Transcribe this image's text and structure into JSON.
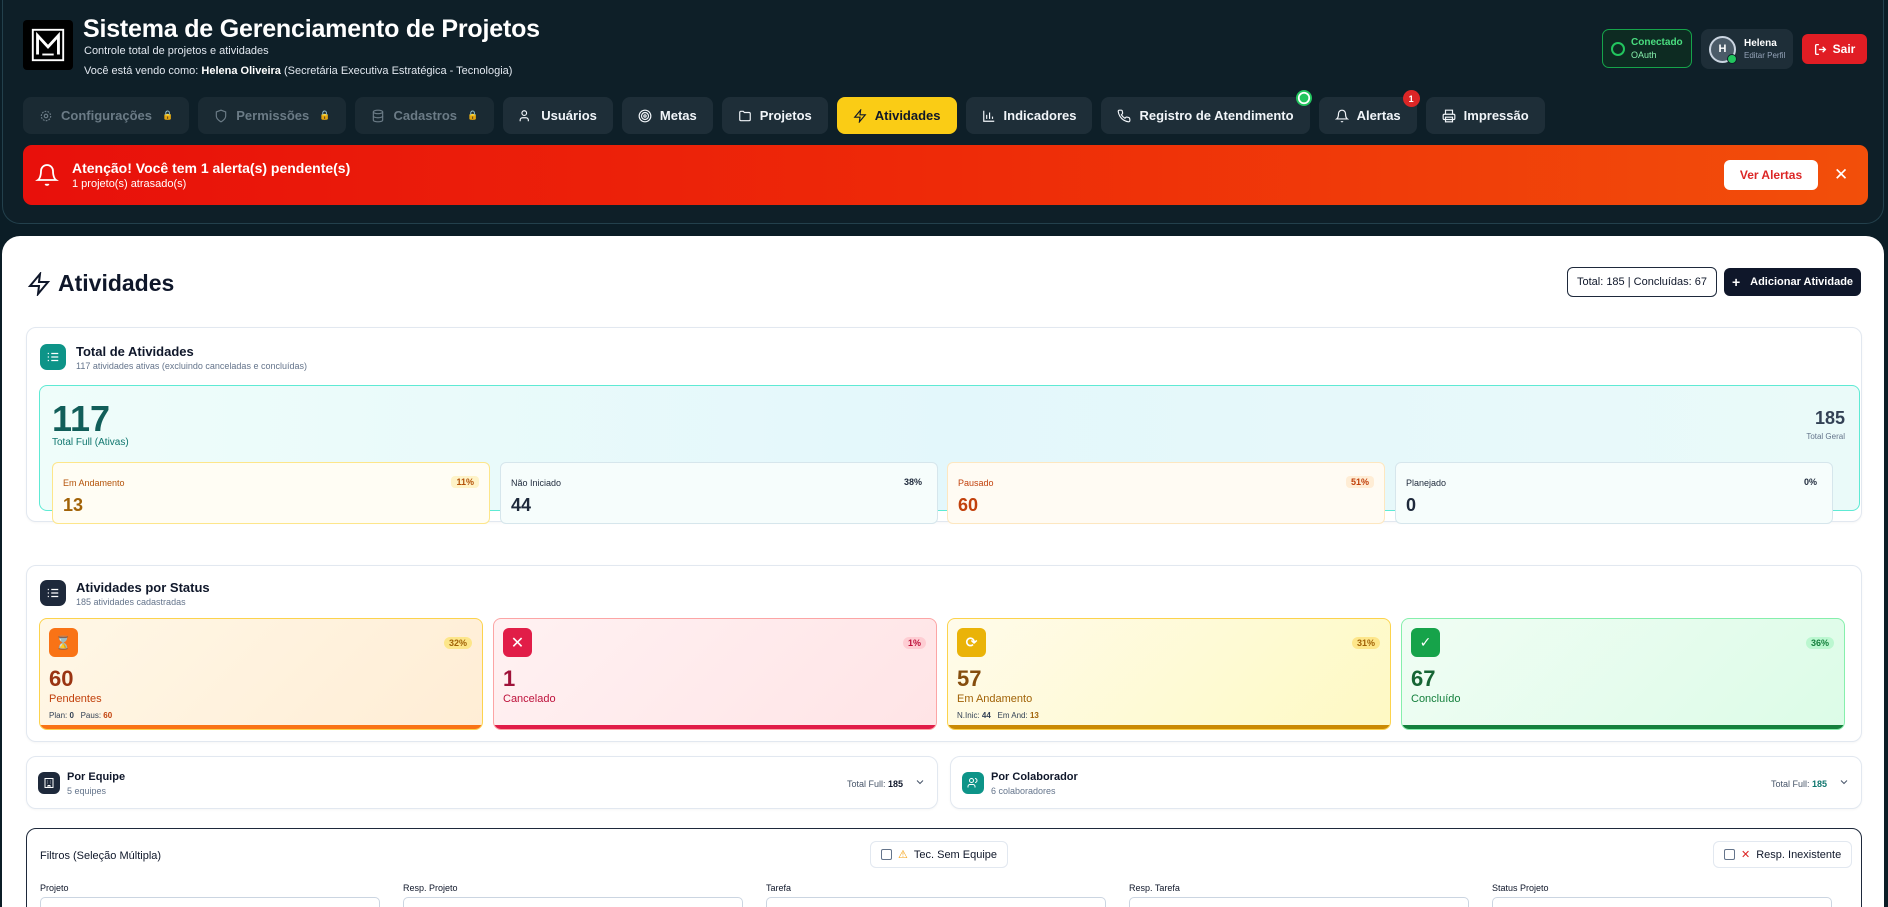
{
  "header": {
    "title": "Sistema de Gerenciamento de Projetos",
    "subtitle": "Controle total de projetos e atividades",
    "viewing_prefix": "Você está vendo como:",
    "viewing_user": "Helena Oliveira",
    "viewing_dept": "(Secretária Executiva Estratégica - Tecnologia)",
    "connection": {
      "status": "Conectado",
      "method": "OAuth"
    },
    "profile": {
      "initial": "H",
      "name": "Helena",
      "action": "Editar Perfil"
    },
    "logout_label": "Sair"
  },
  "tabs": [
    {
      "label": "Configurações",
      "icon": "gear-icon",
      "locked": true
    },
    {
      "label": "Permissões",
      "icon": "shield-icon",
      "locked": true
    },
    {
      "label": "Cadastros",
      "icon": "database-icon",
      "locked": true
    },
    {
      "label": "Usuários",
      "icon": "users-icon",
      "locked": false
    },
    {
      "label": "Metas",
      "icon": "target-icon",
      "locked": false
    },
    {
      "label": "Projetos",
      "icon": "folder-icon",
      "locked": false
    },
    {
      "label": "Atividades",
      "icon": "lightning-icon",
      "locked": false,
      "active": true
    },
    {
      "label": "Indicadores",
      "icon": "bar-chart-icon",
      "locked": false
    },
    {
      "label": "Registro de Atendimento",
      "icon": "phone-icon",
      "locked": false,
      "badge": "whatsapp"
    },
    {
      "label": "Alertas",
      "icon": "bell-icon",
      "locked": false,
      "badge_count": "1"
    },
    {
      "label": "Impressão",
      "icon": "printer-icon",
      "locked": false
    }
  ],
  "alert": {
    "title": "Atenção! Você tem 1 alerta(s) pendente(s)",
    "subtitle": "1 projeto(s) atrasado(s)",
    "button": "Ver Alertas",
    "close": "✕"
  },
  "page": {
    "title": "Atividades",
    "total_badge": "Total: 185 | Concluídas: 67",
    "add_button": "Adicionar Atividade"
  },
  "total_card": {
    "title": "Total de Atividades",
    "subtitle": "117 atividades ativas (excluindo canceladas e concluídas)",
    "total_full": "117",
    "total_full_label": "Total Full (Ativas)",
    "total_geral": "185",
    "total_geral_label": "Total Geral",
    "tiles": [
      {
        "label": "Em Andamento",
        "pct": "11%",
        "value": "13"
      },
      {
        "label": "Não Iniciado",
        "pct": "38%",
        "value": "44"
      },
      {
        "label": "Pausado",
        "pct": "51%",
        "value": "60"
      },
      {
        "label": "Planejado",
        "pct": "0%",
        "value": "0"
      }
    ]
  },
  "status_card": {
    "title": "Atividades por Status",
    "subtitle": "185 atividades cadastradas",
    "tiles": [
      {
        "value": "60",
        "label": "Pendentes",
        "pct": "32%",
        "detail_a_label": "Plan:",
        "detail_a": "0",
        "detail_b_label": "Paus:",
        "detail_b": "60"
      },
      {
        "value": "1",
        "label": "Cancelado",
        "pct": "1%"
      },
      {
        "value": "57",
        "label": "Em Andamento",
        "pct": "31%",
        "detail_a_label": "N.Inic:",
        "detail_a": "44",
        "detail_b_label": "Em And:",
        "detail_b": "13"
      },
      {
        "value": "67",
        "label": "Concluído",
        "pct": "36%"
      }
    ]
  },
  "groups": [
    {
      "title": "Por Equipe",
      "subtitle": "5 equipes",
      "total_label": "Total Full:",
      "total": "185"
    },
    {
      "title": "Por Colaborador",
      "subtitle": "6 colaboradores",
      "total_label": "Total Full:",
      "total": "185"
    }
  ],
  "filters": {
    "title": "Filtros (Seleção Múltipla)",
    "check_sem_equipe": "Tec. Sem Equipe",
    "check_resp_inexistente": "Resp. Inexistente",
    "fields": [
      "Projeto",
      "Resp. Projeto",
      "Tarefa",
      "Resp. Tarefa",
      "Status Projeto"
    ]
  },
  "colors": {
    "accent_yellow": "#facc15",
    "alert_red": "#e8100b",
    "teal": "#0f766e",
    "navy": "#0f172a"
  }
}
